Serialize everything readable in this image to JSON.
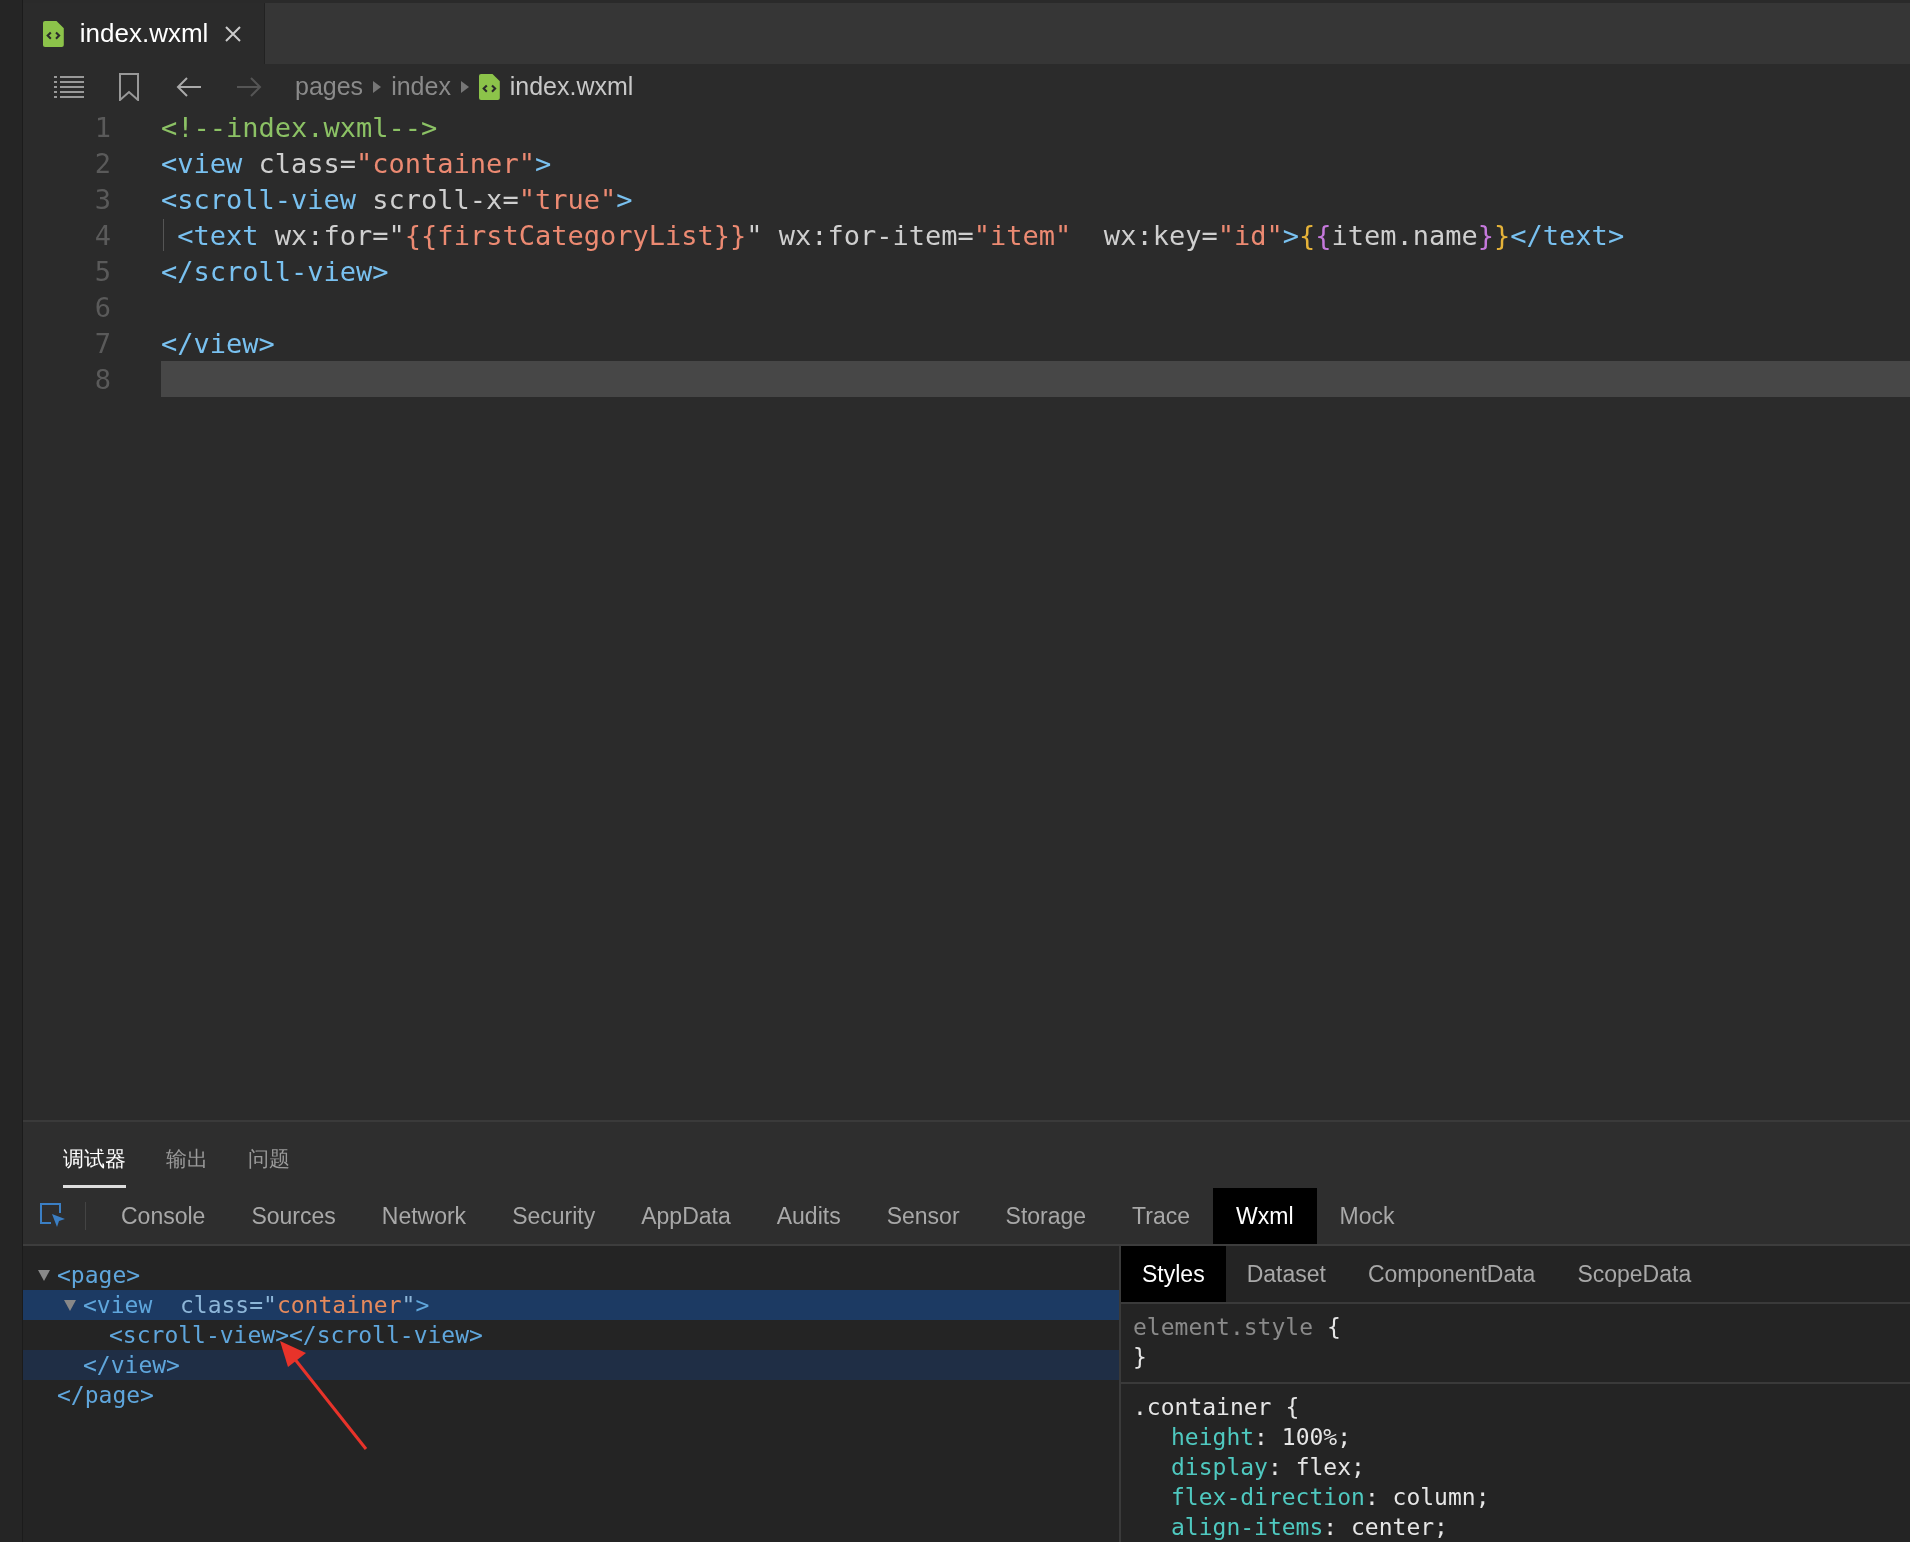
{
  "editor_tabs": [
    {
      "label": "index.wxml",
      "selected": true
    }
  ],
  "breadcrumb": [
    {
      "label": "pages",
      "kind": "folder"
    },
    {
      "label": "index",
      "kind": "folder"
    },
    {
      "label": "index.wxml",
      "kind": "file"
    }
  ],
  "code_lines": [
    {
      "number": "1",
      "tokens": [
        {
          "kind": "comment",
          "text": "<!--index.wxml-->"
        }
      ]
    },
    {
      "number": "2",
      "tokens": [
        {
          "kind": "tag",
          "text": "<view"
        },
        {
          "kind": "attr",
          "text": " class="
        },
        {
          "kind": "string",
          "text": "\"container\""
        },
        {
          "kind": "tag",
          "text": ">"
        }
      ]
    },
    {
      "number": "3",
      "tokens": [
        {
          "kind": "tag",
          "text": "<scroll-view"
        },
        {
          "kind": "attr",
          "text": " scroll-x="
        },
        {
          "kind": "string",
          "text": "\"true\""
        },
        {
          "kind": "tag",
          "text": ">"
        }
      ]
    },
    {
      "number": "4",
      "guide": true,
      "tokens": [
        {
          "kind": "tag",
          "text": " <text"
        },
        {
          "kind": "attr",
          "text": " wx:for="
        },
        {
          "kind": "attr",
          "text": "\""
        },
        {
          "kind": "string",
          "text": "{{firstCategoryList}}"
        },
        {
          "kind": "attr",
          "text": "\" wx:for-item="
        },
        {
          "kind": "string",
          "text": "\"item\""
        },
        {
          "kind": "attr",
          "text": "  wx:key="
        },
        {
          "kind": "string",
          "text": "\"id\""
        },
        {
          "kind": "tag",
          "text": ">"
        },
        {
          "kind": "brace",
          "text": "{"
        },
        {
          "kind": "brace2",
          "text": "{"
        },
        {
          "kind": "attr",
          "text": "item.name"
        },
        {
          "kind": "brace2",
          "text": "}"
        },
        {
          "kind": "brace",
          "text": "}"
        },
        {
          "kind": "tag",
          "text": "</text>"
        }
      ]
    },
    {
      "number": "5",
      "tokens": [
        {
          "kind": "tag",
          "text": "</scroll-view>"
        }
      ]
    },
    {
      "number": "6"
    },
    {
      "number": "7",
      "tokens": [
        {
          "kind": "tag",
          "text": "</view>"
        }
      ]
    },
    {
      "number": "8",
      "current": true
    }
  ],
  "panel_tabs": [
    {
      "label": "调试器",
      "selected": true
    },
    {
      "label": "输出",
      "selected": false
    },
    {
      "label": "问题",
      "selected": false
    }
  ],
  "devtools_tabs": [
    {
      "label": "Console",
      "selected": false
    },
    {
      "label": "Sources",
      "selected": false
    },
    {
      "label": "Network",
      "selected": false
    },
    {
      "label": "Security",
      "selected": false
    },
    {
      "label": "AppData",
      "selected": false
    },
    {
      "label": "Audits",
      "selected": false
    },
    {
      "label": "Sensor",
      "selected": false
    },
    {
      "label": "Storage",
      "selected": false
    },
    {
      "label": "Trace",
      "selected": false
    },
    {
      "label": "Wxml",
      "selected": true
    },
    {
      "label": "Mock",
      "selected": false
    }
  ],
  "wxml_tree": [
    {
      "expanded": true,
      "selected": false,
      "hovered": false,
      "open": [
        {
          "kind": "tag",
          "text": "<page>"
        }
      ],
      "close": [
        {
          "kind": "tag",
          "text": "</page>"
        }
      ],
      "children": [
        {
          "expanded": true,
          "selected": true,
          "hovered": true,
          "open": [
            {
              "kind": "tag",
              "text": "<view "
            },
            {
              "kind": "attr",
              "text": " class="
            },
            {
              "kind": "plain",
              "text": "\""
            },
            {
              "kind": "string",
              "text": "container"
            },
            {
              "kind": "plain",
              "text": "\""
            },
            {
              "kind": "tag",
              "text": ">"
            }
          ],
          "close": [
            {
              "kind": "tag",
              "text": "</view>"
            }
          ],
          "children": [
            {
              "selected": false,
              "open": [
                {
                  "kind": "tag",
                  "text": "<scroll-view></scroll-view>"
                }
              ]
            }
          ]
        }
      ]
    }
  ],
  "side_tabs": [
    {
      "label": "Styles",
      "selected": true
    },
    {
      "label": "Dataset",
      "selected": false
    },
    {
      "label": "ComponentData",
      "selected": false
    },
    {
      "label": "ScopeData",
      "selected": false
    }
  ],
  "style_rules": [
    {
      "selector": "element.style",
      "kind": "inline",
      "open": "{",
      "close": "}"
    },
    {
      "selector": ".container",
      "kind": "class",
      "open": "{",
      "declarations": [
        {
          "property": "height",
          "value": ": 100%;"
        },
        {
          "property": "display",
          "value": ": flex;"
        },
        {
          "property": "flex-direction",
          "value": ": column;"
        },
        {
          "property": "align-items",
          "value": ": center;"
        }
      ]
    }
  ]
}
